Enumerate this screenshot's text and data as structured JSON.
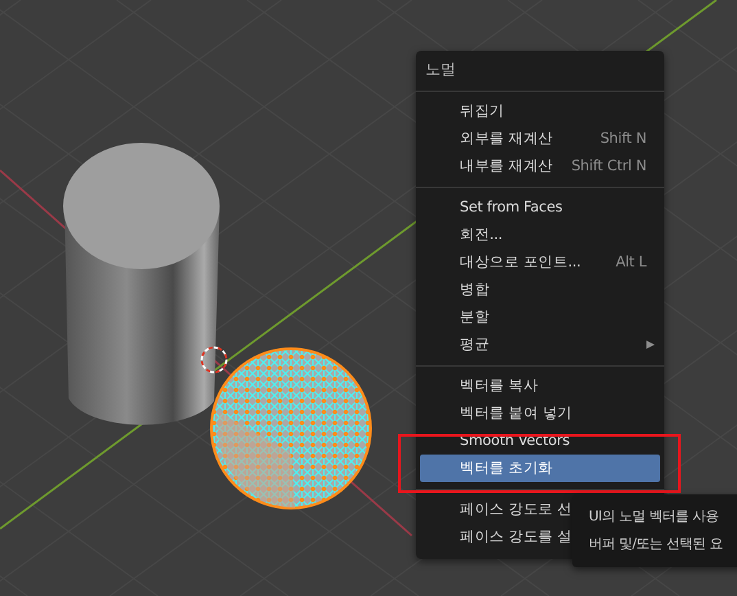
{
  "menu": {
    "title": "노멀",
    "sections": [
      {
        "items": [
          {
            "label": "뒤집기",
            "submenu": false,
            "selected": false
          },
          {
            "label": "외부를 재계산",
            "shortcut": "Shift N",
            "submenu": false,
            "selected": false
          },
          {
            "label": "내부를 재계산",
            "shortcut": "Shift Ctrl N",
            "submenu": false,
            "selected": false
          }
        ]
      },
      {
        "items": [
          {
            "label": "Set from Faces",
            "submenu": false,
            "selected": false
          },
          {
            "label": "회전...",
            "submenu": false,
            "selected": false
          },
          {
            "label": "대상으로 포인트...",
            "shortcut": "Alt L",
            "submenu": false,
            "selected": false
          },
          {
            "label": "병합",
            "submenu": false,
            "selected": false
          },
          {
            "label": "분할",
            "submenu": false,
            "selected": false
          },
          {
            "label": "평균",
            "submenu": true,
            "selected": false
          }
        ]
      },
      {
        "items": [
          {
            "label": "벡터를 복사",
            "submenu": false,
            "selected": false
          },
          {
            "label": "벡터를 붙여 넣기",
            "submenu": false,
            "selected": false
          },
          {
            "label": "Smooth Vectors",
            "submenu": false,
            "selected": false
          },
          {
            "label": "벡터를 초기화",
            "submenu": false,
            "selected": true
          }
        ]
      },
      {
        "items": [
          {
            "label": "페이스 강도로 선",
            "submenu": false,
            "selected": false
          },
          {
            "label": "페이스 강도를 설",
            "submenu": false,
            "selected": false
          }
        ]
      }
    ]
  },
  "tooltip": {
    "lines": [
      "UI의 노멀 벡터를 사용",
      "버퍼 및/또는 선택된 요"
    ]
  }
}
